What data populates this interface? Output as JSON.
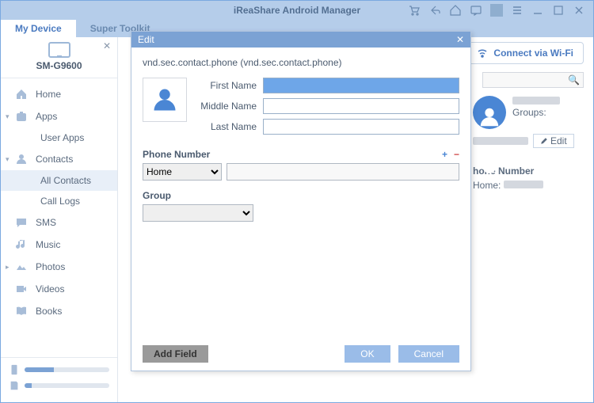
{
  "app": {
    "title": "iReaShare Android Manager"
  },
  "tabs": {
    "device": "My Device",
    "toolkit": "Super Toolkit"
  },
  "device": {
    "name": "SM-G9600"
  },
  "nav": {
    "home": "Home",
    "apps": "Apps",
    "userapps": "User Apps",
    "contacts": "Contacts",
    "allcontacts": "All Contacts",
    "calllogs": "Call Logs",
    "sms": "SMS",
    "music": "Music",
    "photos": "Photos",
    "videos": "Videos",
    "books": "Books"
  },
  "wifi": {
    "label": "Connect via Wi-Fi"
  },
  "detail": {
    "groups_label": "Groups:",
    "edit": "Edit",
    "phone_label": "hone Number",
    "phone_type": "Home:"
  },
  "modal": {
    "title": "Edit",
    "header": "vnd.sec.contact.phone (vnd.sec.contact.phone)",
    "first": "First Name",
    "middle": "Middle Name",
    "last": "Last Name",
    "phone": "Phone Number",
    "phone_type": "Home",
    "group": "Group",
    "addfield": "Add Field",
    "ok": "OK",
    "cancel": "Cancel"
  }
}
